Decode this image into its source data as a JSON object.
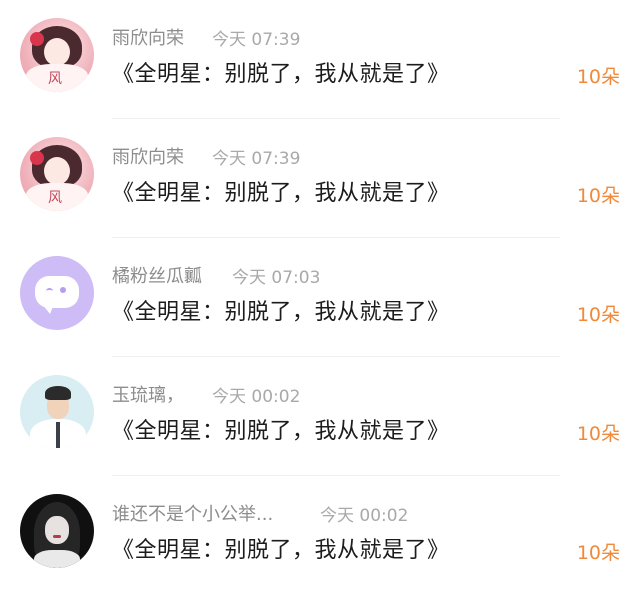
{
  "items": [
    {
      "name": "雨欣向荣",
      "time": "今天 07:39",
      "message": "《全明星：别脱了，我从就是了》",
      "amount": "10朵",
      "avatar": "anime-girl-avatar"
    },
    {
      "name": "雨欣向荣",
      "time": "今天 07:39",
      "message": "《全明星：别脱了，我从就是了》",
      "amount": "10朵",
      "avatar": "anime-girl-avatar"
    },
    {
      "name": "橘粉丝瓜瓤",
      "time": "今天 07:03",
      "message": "《全明星：别脱了，我从就是了》",
      "amount": "10朵",
      "avatar": "chat-bubble-avatar"
    },
    {
      "name": "玉琉璃，",
      "time": "今天 00:02",
      "message": "《全明星：别脱了，我从就是了》",
      "amount": "10朵",
      "avatar": "man-suit-avatar"
    },
    {
      "name": "谁还不是个小公举...",
      "time": "今天 00:02",
      "message": "《全明星：别脱了，我从就是了》",
      "amount": "10朵",
      "avatar": "dark-girl-avatar"
    }
  ],
  "colors": {
    "amount": "#f08a3a",
    "name": "#8d8d8d",
    "time": "#a9a9a9",
    "message": "#1c1c1c"
  }
}
